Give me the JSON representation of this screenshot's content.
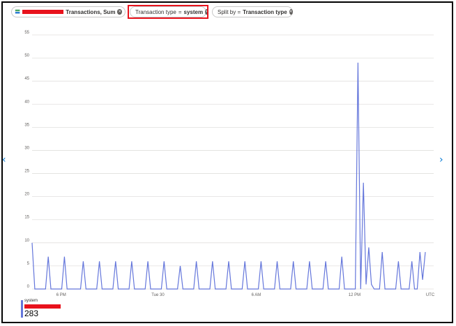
{
  "pills": {
    "metric": {
      "label": "Transactions, Sum"
    },
    "filter": {
      "prefix": "Transaction type",
      "op": "=",
      "value": "system"
    },
    "split": {
      "prefix": "Split by =",
      "value": "Transaction type"
    }
  },
  "chart_data": {
    "type": "line",
    "y_ticks": [
      "55",
      "50",
      "45",
      "40",
      "35",
      "30",
      "25",
      "20",
      "15",
      "10",
      "5",
      "0"
    ],
    "x_tick_labels": [
      "6 PM",
      "Tue 30",
      "6 AM",
      "12 PM"
    ],
    "timezone_label": "UTC",
    "ylim": [
      0,
      55
    ],
    "grid": true,
    "color": "#6476db",
    "series": [
      {
        "values": [
          10,
          0,
          0,
          0,
          0,
          0,
          7,
          0,
          0,
          0,
          0,
          0,
          7,
          0,
          0,
          0,
          0,
          0,
          0,
          6,
          0,
          0,
          0,
          0,
          0,
          6,
          0,
          0,
          0,
          0,
          0,
          6,
          0,
          0,
          0,
          0,
          0,
          6,
          0,
          0,
          0,
          0,
          0,
          6,
          0,
          0,
          0,
          0,
          0,
          6,
          0,
          0,
          0,
          0,
          0,
          5,
          0,
          0,
          0,
          0,
          0,
          6,
          0,
          0,
          0,
          0,
          0,
          6,
          0,
          0,
          0,
          0,
          0,
          6,
          0,
          0,
          0,
          0,
          0,
          6,
          0,
          0,
          0,
          0,
          0,
          6,
          0,
          0,
          0,
          0,
          0,
          6,
          0,
          0,
          0,
          0,
          0,
          6,
          0,
          0,
          0,
          0,
          0,
          6,
          0,
          0,
          0,
          0,
          0,
          6,
          0,
          0,
          0,
          0,
          0,
          7,
          0,
          0,
          0,
          0,
          0,
          49,
          0,
          23,
          1,
          9,
          1,
          0,
          0,
          0,
          8,
          0,
          0,
          0,
          0,
          0,
          6,
          0,
          0,
          0,
          0,
          6,
          0,
          0,
          8,
          2,
          8
        ]
      }
    ]
  },
  "legend": {
    "series_name": "system",
    "total": "283"
  }
}
